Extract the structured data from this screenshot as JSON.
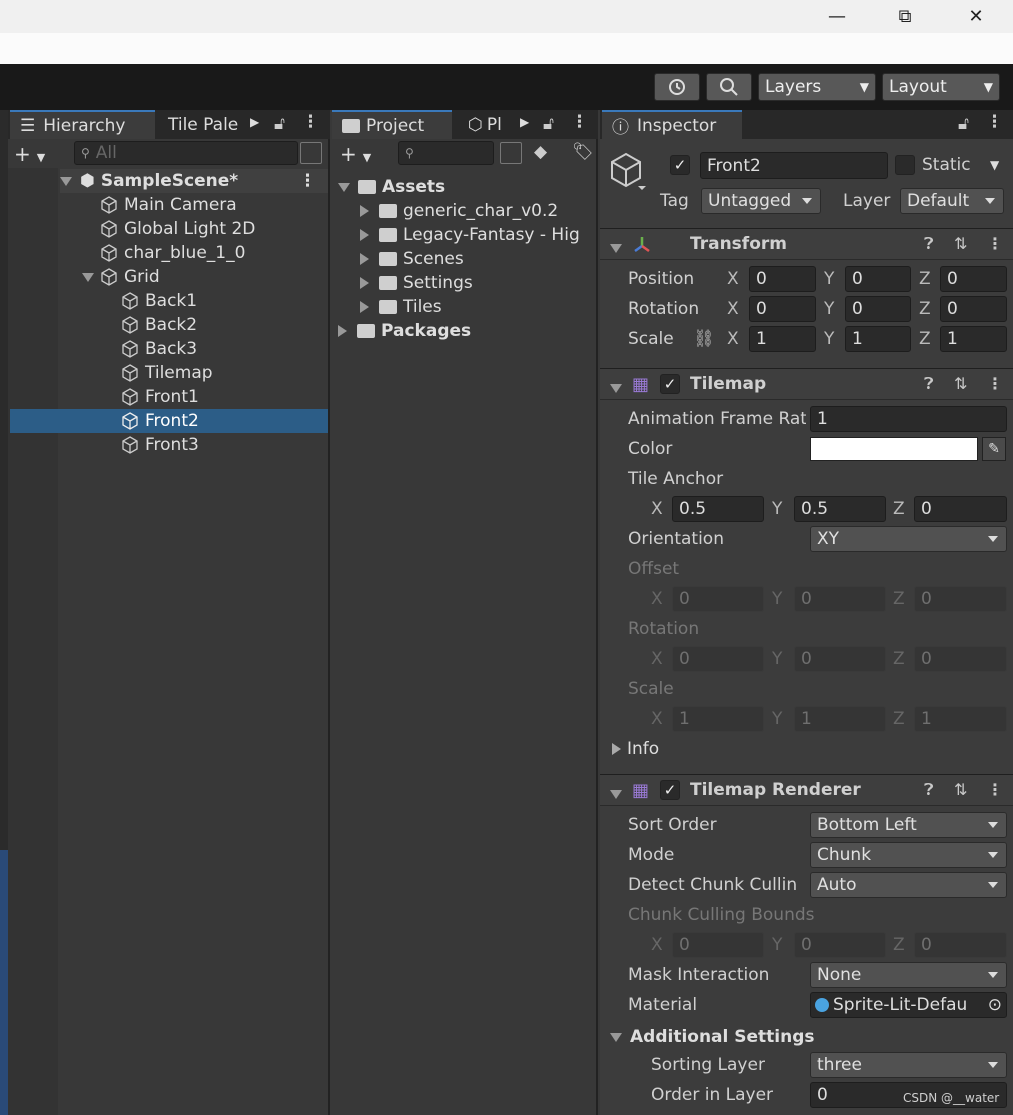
{
  "window": {
    "minimize": "—",
    "restore": "⧉",
    "close": "✕"
  },
  "toolbar": {
    "layers_label": "Layers",
    "layout_label": "Layout"
  },
  "hierarchy": {
    "tab_label": "Hierarchy",
    "tile_tab_label": "Tile Pale",
    "search_placeholder": "All",
    "items": [
      {
        "label": "SampleScene*"
      },
      {
        "label": "Main Camera"
      },
      {
        "label": "Global Light 2D"
      },
      {
        "label": "char_blue_1_0"
      },
      {
        "label": "Grid"
      },
      {
        "label": "Back1"
      },
      {
        "label": "Back2"
      },
      {
        "label": "Back3"
      },
      {
        "label": "Tilemap"
      },
      {
        "label": "Front1"
      },
      {
        "label": "Front2"
      },
      {
        "label": "Front3"
      }
    ]
  },
  "project": {
    "tab_label": "Project",
    "pl_tab_label": "Pl",
    "items": [
      {
        "label": "Assets"
      },
      {
        "label": "generic_char_v0.2"
      },
      {
        "label": "Legacy-Fantasy - Hig"
      },
      {
        "label": "Scenes"
      },
      {
        "label": "Settings"
      },
      {
        "label": "Tiles"
      },
      {
        "label": "Packages"
      }
    ]
  },
  "inspector": {
    "tab_label": "Inspector",
    "object_name": "Front2",
    "static_label": "Static",
    "tag_label": "Tag",
    "tag_value": "Untagged",
    "layer_label": "Layer",
    "layer_value": "Default",
    "transform": {
      "title": "Transform",
      "position_label": "Position",
      "rotation_label": "Rotation",
      "scale_label": "Scale",
      "position": [
        "0",
        "0",
        "0"
      ],
      "rotation": [
        "0",
        "0",
        "0"
      ],
      "scale": [
        "1",
        "1",
        "1"
      ]
    },
    "axes": {
      "x": "X",
      "y": "Y",
      "z": "Z"
    },
    "tilemap": {
      "title": "Tilemap",
      "anim_label": "Animation Frame Rat",
      "anim_value": "1",
      "color_label": "Color",
      "anchor_label": "Tile Anchor",
      "anchor": [
        "0.5",
        "0.5",
        "0"
      ],
      "orientation_label": "Orientation",
      "orientation_value": "XY",
      "offset_label": "Offset",
      "offset": [
        "0",
        "0",
        "0"
      ],
      "rotation_label": "Rotation",
      "rotation": [
        "0",
        "0",
        "0"
      ],
      "scale_label": "Scale",
      "scale": [
        "1",
        "1",
        "1"
      ],
      "info_label": "Info"
    },
    "renderer": {
      "title": "Tilemap Renderer",
      "sort_label": "Sort Order",
      "sort_value": "Bottom Left",
      "mode_label": "Mode",
      "mode_value": "Chunk",
      "detect_label": "Detect Chunk Cullin",
      "detect_value": "Auto",
      "bounds_label": "Chunk Culling Bounds",
      "bounds": [
        "0",
        "0",
        "0"
      ],
      "mask_label": "Mask Interaction",
      "mask_value": "None",
      "material_label": "Material",
      "material_value": "Sprite-Lit-Defau",
      "additional_label": "Additional Settings",
      "sorting_layer_label": "Sorting Layer",
      "sorting_layer_value": "three",
      "order_label": "Order in Layer",
      "order_value": "0"
    }
  },
  "watermark": "CSDN @__water",
  "colors": {
    "selection": "#2c5d87",
    "accent": "#3a79bb",
    "panel": "#383838",
    "toolbar": "#191919"
  }
}
